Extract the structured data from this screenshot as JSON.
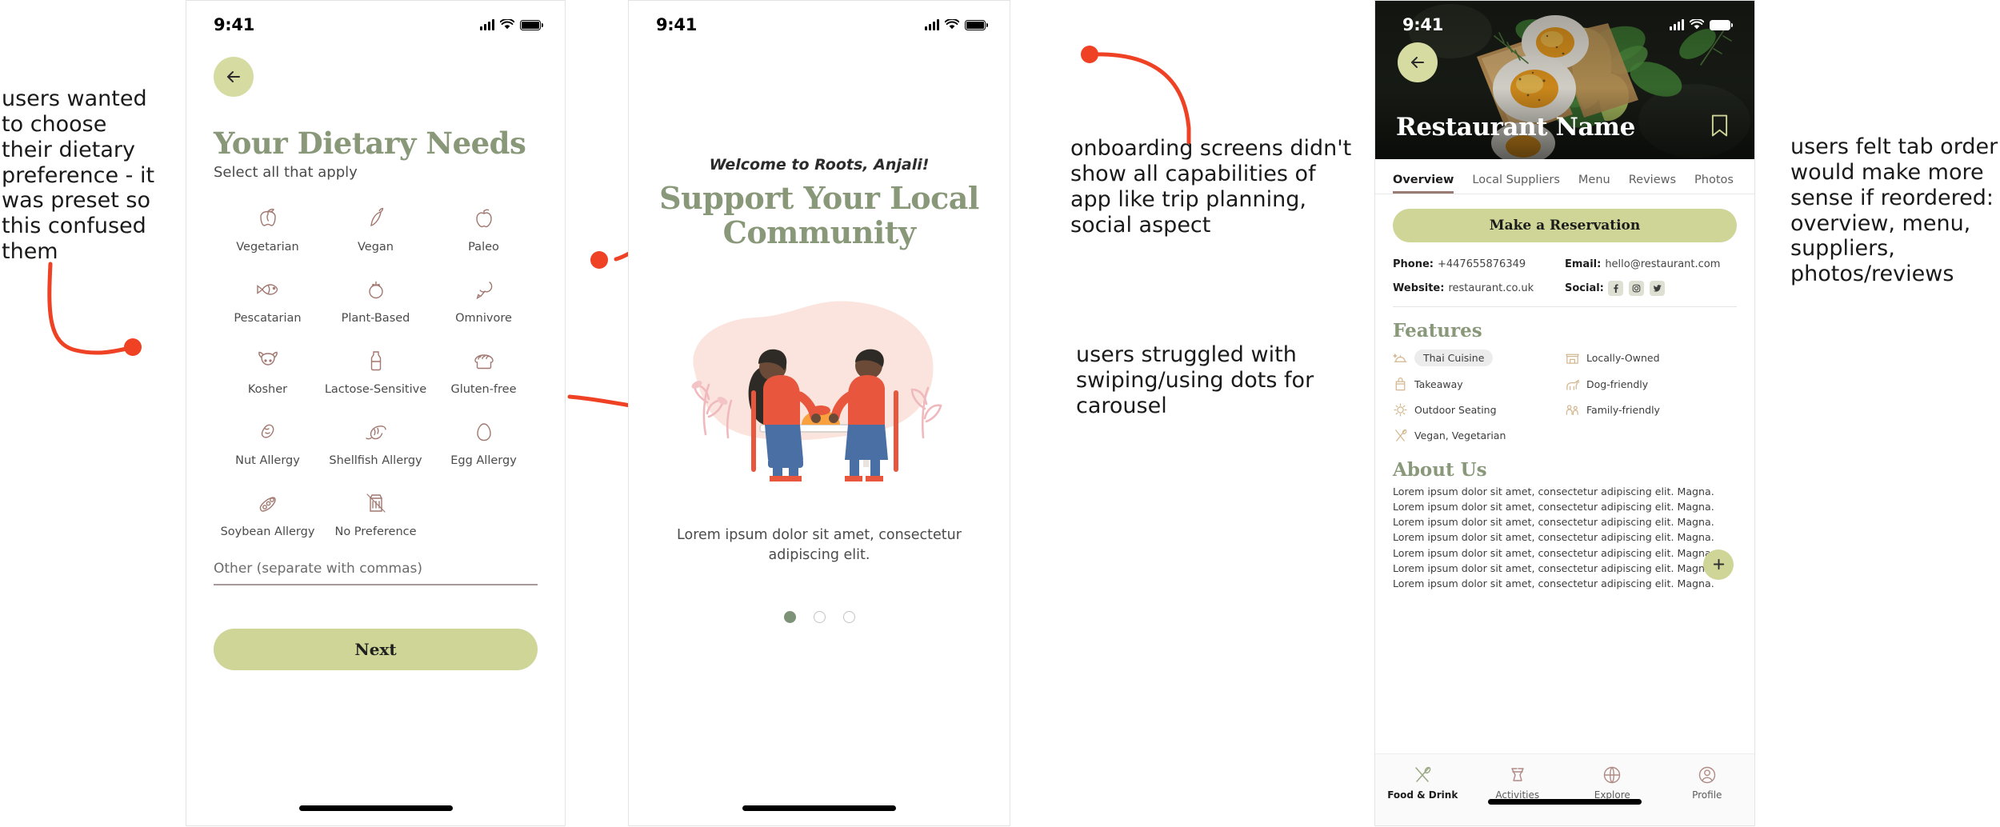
{
  "annotations": [
    {
      "id": "dietary",
      "text": "users wanted to choose their dietary preference - it was preset so this confused them"
    },
    {
      "id": "onboard",
      "text": "onboarding screens didn't show all capabilities of app like trip planning, social aspect"
    },
    {
      "id": "carousel",
      "text": "users struggled with swiping/using dots for carousel"
    },
    {
      "id": "taborder",
      "text": "users felt tab order would make more sense if reordered: overview, menu, suppliers, photos/reviews"
    }
  ],
  "colors": {
    "annotation_red": "#ef4123",
    "sage_green": "#889878",
    "olive_button": "#cfd497",
    "tab_underline": "#9a7b74",
    "icon_rose": "#a1776f",
    "feature_tan": "#d3b78f",
    "dot_active": "#7e9277"
  },
  "screen1": {
    "status": {
      "time": "9:41"
    },
    "back_icon": "arrow-left-icon",
    "title": "Your Dietary Needs",
    "subtitle": "Select all that apply",
    "options": [
      {
        "label": "Vegetarian",
        "icon": "bell-pepper-icon"
      },
      {
        "label": "Vegan",
        "icon": "chili-sprout-icon"
      },
      {
        "label": "Paleo",
        "icon": "apple-icon"
      },
      {
        "label": "Pescatarian",
        "icon": "fish-icon"
      },
      {
        "label": "Plant-Based",
        "icon": "tomato-icon"
      },
      {
        "label": "Omnivore",
        "icon": "drumstick-icon"
      },
      {
        "label": "Kosher",
        "icon": "cow-icon"
      },
      {
        "label": "Lactose-Sensitive",
        "icon": "milk-bottle-icon"
      },
      {
        "label": "Gluten-free",
        "icon": "bread-icon"
      },
      {
        "label": "Nut Allergy",
        "icon": "peanut-icon"
      },
      {
        "label": "Shellfish Allergy",
        "icon": "shrimp-icon"
      },
      {
        "label": "Egg Allergy",
        "icon": "egg-icon"
      },
      {
        "label": "Soybean Allergy",
        "icon": "soybean-icon"
      },
      {
        "label": "No Preference",
        "icon": "no-preference-icon"
      }
    ],
    "other_label": "Other (separate with commas)",
    "other_value": "",
    "next_label": "Next"
  },
  "screen2": {
    "status": {
      "time": "9:41"
    },
    "welcome": "Welcome to Roots, Anjali!",
    "title": "Support Your Local Community",
    "body": "Lorem ipsum dolor sit amet, consectetur adipiscing elit.",
    "carousel": {
      "total": 3,
      "active_index": 0
    }
  },
  "screen3": {
    "status": {
      "time": "9:41"
    },
    "back_icon": "arrow-left-icon",
    "restaurant_name": "Restaurant Name",
    "bookmark_icon": "bookmark-icon",
    "tabs": [
      {
        "label": "Overview",
        "active": true
      },
      {
        "label": "Local Suppliers",
        "active": false
      },
      {
        "label": "Menu",
        "active": false
      },
      {
        "label": "Reviews",
        "active": false
      },
      {
        "label": "Photos",
        "active": false
      }
    ],
    "reserve_label": "Make a Reservation",
    "contact": {
      "phone_label": "Phone:",
      "phone_value": "+447655876349",
      "email_label": "Email:",
      "email_value": "hello@restaurant.com",
      "website_label": "Website:",
      "website_value": "restaurant.co.uk",
      "social_label": "Social:",
      "social_icons": [
        "facebook-icon",
        "instagram-icon",
        "twitter-icon"
      ]
    },
    "features_title": "Features",
    "features": [
      {
        "label": "Thai Cuisine",
        "icon": "cloche-icon",
        "pill": true
      },
      {
        "label": "Locally-Owned",
        "icon": "shop-icon",
        "pill": false
      },
      {
        "label": "Takeaway",
        "icon": "takeaway-bag-icon",
        "pill": false
      },
      {
        "label": "Dog-friendly",
        "icon": "dog-icon",
        "pill": false
      },
      {
        "label": "Outdoor Seating",
        "icon": "sun-icon",
        "pill": false
      },
      {
        "label": "Family-friendly",
        "icon": "family-icon",
        "pill": false
      },
      {
        "label": "Vegan, Vegetarian",
        "icon": "cutlery-icon",
        "pill": false
      }
    ],
    "about_title": "About Us",
    "about_body": "Lorem ipsum dolor sit amet, consectetur adipiscing elit. Magna. Lorem ipsum dolor sit amet, consectetur adipiscing elit. Magna. Lorem ipsum dolor sit amet, consectetur adipiscing elit. Magna. Lorem ipsum dolor sit amet, consectetur adipiscing elit. Magna. Lorem ipsum dolor sit amet, consectetur adipiscing elit. Magna. Lorem ipsum dolor sit amet, consectetur adipiscing elit. Magna. Lorem ipsum dolor sit amet, consectetur adipiscing elit. Magna.",
    "add_icon": "plus-icon",
    "bottom_nav": [
      {
        "label": "Food & Drink",
        "icon": "cutlery-icon",
        "active": true
      },
      {
        "label": "Activities",
        "icon": "cheers-icon",
        "active": false
      },
      {
        "label": "Explore",
        "icon": "globe-icon",
        "active": false
      },
      {
        "label": "Profile",
        "icon": "person-icon",
        "active": false
      }
    ]
  }
}
